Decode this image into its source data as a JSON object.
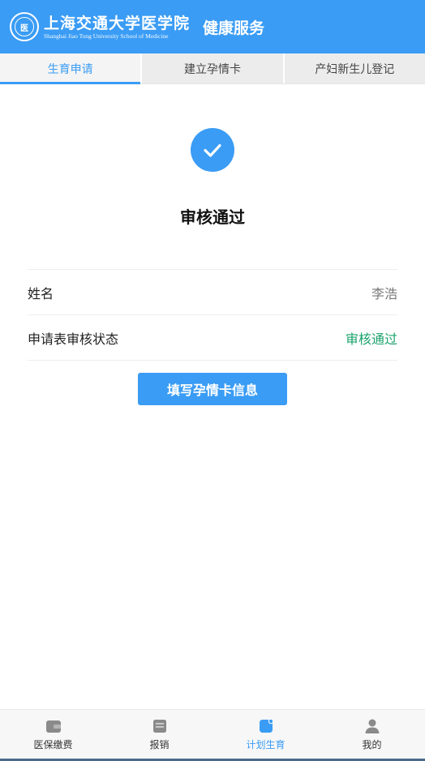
{
  "header": {
    "logo_cn": "上海交通大学医学院",
    "logo_en": "Shanghai Jiao Tong University School of Medicine",
    "title": "健康服务"
  },
  "tabs": [
    {
      "label": "生育申请",
      "active": true
    },
    {
      "label": "建立孕情卡",
      "active": false
    },
    {
      "label": "产妇新生儿登记",
      "active": false
    }
  ],
  "status": {
    "title": "审核通过",
    "icon": "check-circle-icon"
  },
  "info": [
    {
      "label": "姓名",
      "value": "李浩"
    },
    {
      "label": "申请表审核状态",
      "value": "审核通过"
    }
  ],
  "action_button": "填写孕情卡信息",
  "bottom_nav": [
    {
      "label": "医保缴费",
      "icon": "wallet-icon",
      "active": false
    },
    {
      "label": "报销",
      "icon": "receipt-icon",
      "active": false
    },
    {
      "label": "计划生育",
      "icon": "family-plan-icon",
      "active": true
    },
    {
      "label": "我的",
      "icon": "user-icon",
      "active": false
    }
  ],
  "colors": {
    "primary": "#3a9cf5",
    "success": "#1aa36b"
  }
}
